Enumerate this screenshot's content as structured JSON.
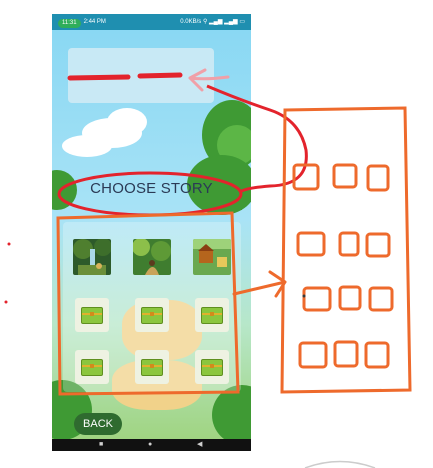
{
  "status_bar": {
    "call_time": "11:31",
    "clock": "2:44 PM",
    "right_info": "0.0KB/s ⚲ ▂▄▆ ▂▄▆ ▭"
  },
  "screen": {
    "choose_title": "CHOOSE STORY",
    "back_label": "BACK",
    "stories": [
      {
        "name": "forest-waterfall-story",
        "colors": [
          "#2d5a2a",
          "#6b8f3a",
          "#d7b35a"
        ]
      },
      {
        "name": "jungle-path-story",
        "colors": [
          "#3f7d2f",
          "#8cbf4a",
          "#5c3b1e"
        ]
      },
      {
        "name": "farm-story",
        "colors": [
          "#6aa84f",
          "#b5651d",
          "#e6c85a"
        ]
      }
    ],
    "locked_chests": [
      1,
      2,
      3,
      4,
      5,
      6
    ]
  },
  "nav_bar": {
    "recent": "■",
    "home": "●",
    "back": "◀"
  },
  "colors": {
    "annotation_red": "#e3232c",
    "annotation_orange": "#ee6a2c",
    "button_green": "#2f6b2f"
  }
}
